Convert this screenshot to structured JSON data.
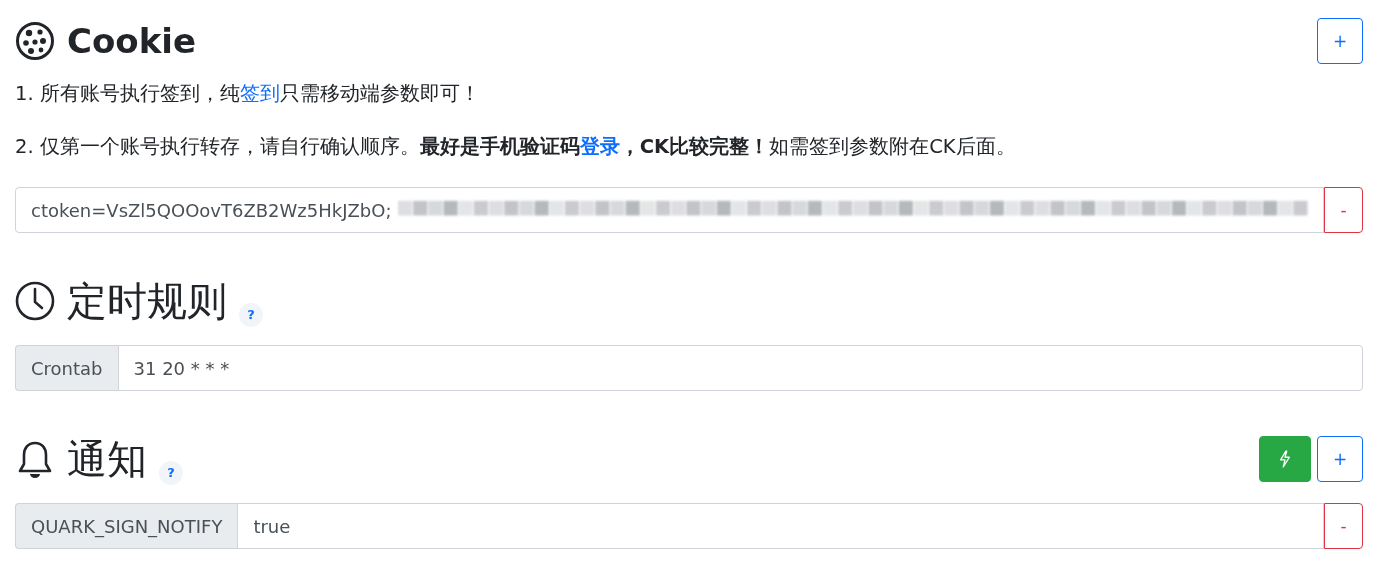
{
  "cookie": {
    "title": "Cookie",
    "add_button": "+",
    "notes": [
      [
        {
          "kind": "text",
          "text": "1. 所有账号执行签到，纯"
        },
        {
          "kind": "link",
          "text": "签到"
        },
        {
          "kind": "text",
          "text": "只需移动端参数即可！"
        }
      ],
      [
        {
          "kind": "text",
          "text": "2. 仅第一个账号执行转存，请自行确认顺序。**最好是手机验证码**"
        },
        {
          "kind": "link",
          "text": "**登录**"
        },
        {
          "kind": "text",
          "text": "**，CK比较完整！**如需签到参数附在CK后面。"
        }
      ]
    ],
    "entries": [
      {
        "value": "ctoken=VsZl5QOOovT6ZB2Wz5HkJZbO;",
        "redacted": true,
        "remove_button": "-"
      }
    ]
  },
  "schedule": {
    "title": "定时规则",
    "help": "?",
    "label": "Crontab",
    "value": "31 20 * * *"
  },
  "notify": {
    "title": "通知",
    "help": "?",
    "add_button": "+",
    "entries": [
      {
        "label": "QUARK_SIGN_NOTIFY",
        "value": "true",
        "remove_button": "-"
      }
    ]
  }
}
